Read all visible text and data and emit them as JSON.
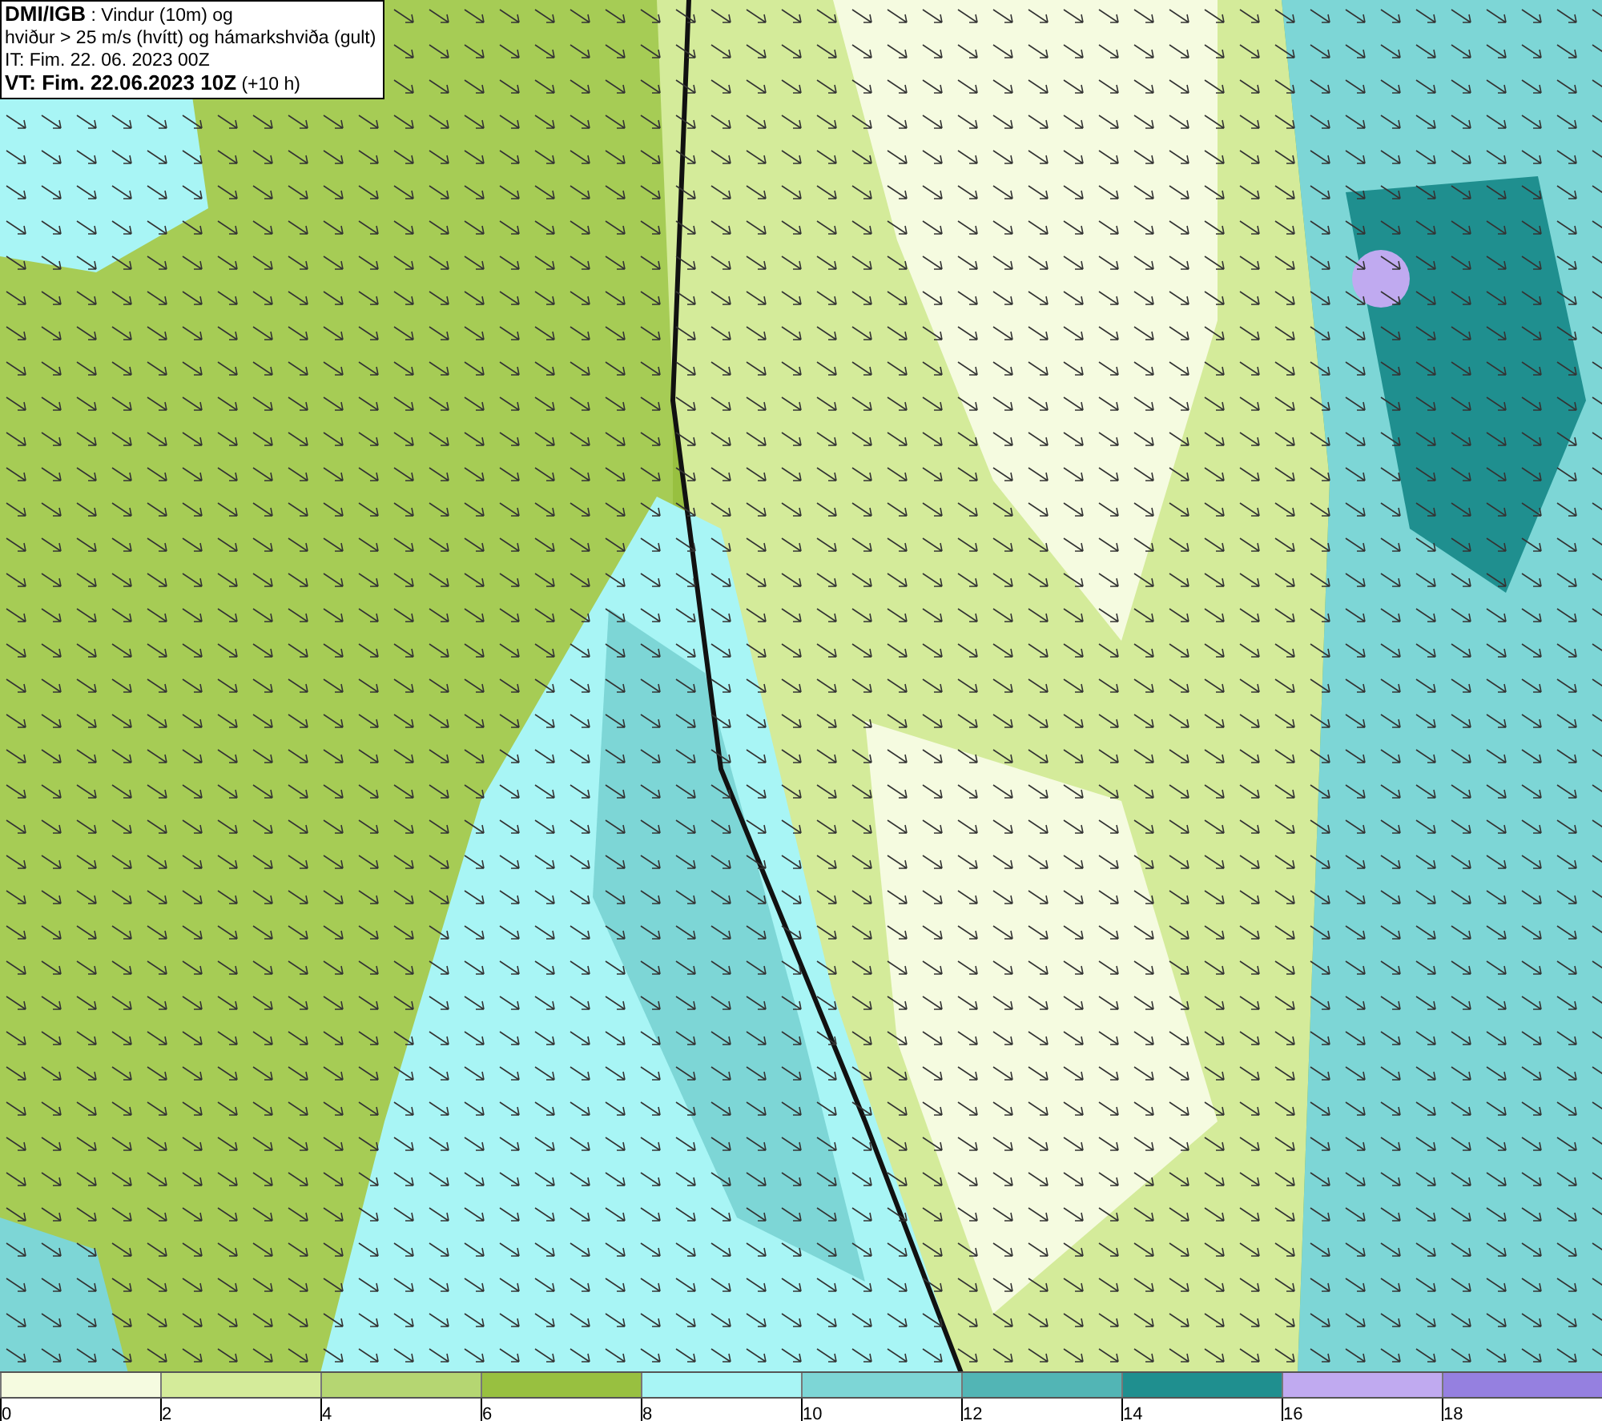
{
  "title_box": {
    "lines": [
      "**DMI/IGB** : Vindur (10m) og",
      "hviður > 25 m/s (hvítt) og hámarkshviða (gult)",
      "IT: Fim. 22. 06. 2023 00Z",
      "**VT: Fim. 22.06.2023 10Z** (+10 h)"
    ]
  },
  "legend": {
    "swatches": [
      {
        "color": "#f5fbe0"
      },
      {
        "color": "#d4eb9a"
      },
      {
        "color": "#b5d672"
      },
      {
        "color": "#98c040"
      },
      {
        "color": "#a8f5f5"
      },
      {
        "color": "#7dd6d6"
      },
      {
        "color": "#52b5b5"
      },
      {
        "color": "#1f8f8f"
      },
      {
        "color": "#c0aaf0"
      },
      {
        "color": "#9580e0"
      }
    ],
    "ticks": [
      "0",
      "2",
      "4",
      "6",
      "8",
      "10",
      "12",
      "14",
      "16",
      "18"
    ]
  }
}
